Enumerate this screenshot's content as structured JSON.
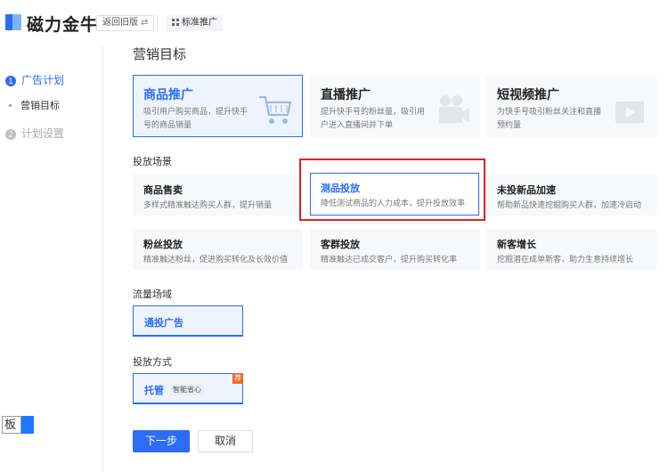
{
  "header": {
    "brand": "磁力金牛",
    "back_button": "返回旧版",
    "switch_glyph": "⇄",
    "mode_tag": "标准推广"
  },
  "sidebar": {
    "steps": [
      {
        "num": "1",
        "label": "广告计划"
      },
      {
        "num": "2",
        "label": "计划设置"
      }
    ],
    "substep": "营销目标",
    "stub_text": "板"
  },
  "main": {
    "title": "营销目标",
    "goals": [
      {
        "title": "商品推广",
        "desc": "吸引用户购买商品，提升快手号的商品销量",
        "icon": "shopping-cart-icon"
      },
      {
        "title": "直播推广",
        "desc": "提升快手号的粉丝量，吸引用户进入直播间并下单",
        "icon": "video-camera-icon"
      },
      {
        "title": "短视频推广",
        "desc": "为快手号吸引粉丝关注和直播预约量",
        "icon": "video-play-icon"
      }
    ],
    "scene_label": "投放场景",
    "scenes": [
      {
        "title": "商品售卖",
        "desc": "多样式精准触达购买人群，提升销量"
      },
      {
        "title": "测品投放",
        "desc": "降低测试商品的人力成本，提升投放效率"
      },
      {
        "title": "未投新品加速",
        "desc": "帮助新品快速挖掘购买人群，加速冷启动"
      },
      {
        "title": "粉丝投放",
        "desc": "精准触达粉丝，促进购买转化及长效价值"
      },
      {
        "title": "客群投放",
        "desc": "精准触达已成交客户，提升购买转化率"
      },
      {
        "title": "新客增长",
        "desc": "挖掘潜在成单新客，助力生意持续增长"
      }
    ],
    "traffic_label": "流量场域",
    "traffic_option": "通投广告",
    "method_label": "投放方式",
    "method_option": "托管",
    "method_tag": "智能省心",
    "method_badge": "荐",
    "next_button": "下一步",
    "cancel_button": "取消"
  },
  "colors": {
    "accent": "#2c6cf6",
    "highlight_box": "#e02020",
    "badge": "#f06a2a"
  }
}
